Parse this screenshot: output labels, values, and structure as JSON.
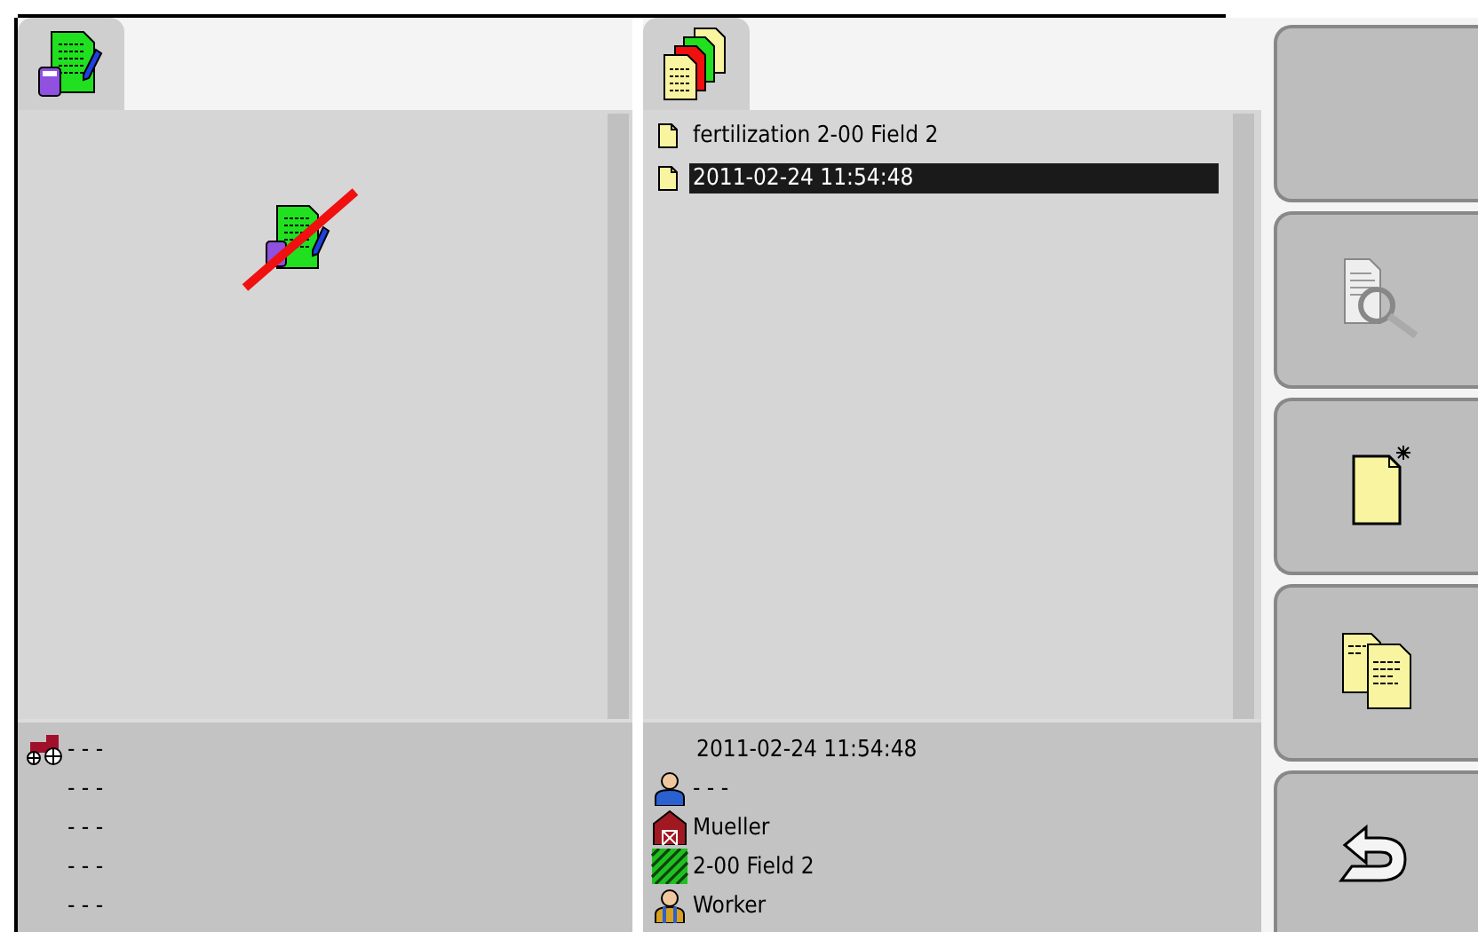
{
  "left_panel": {
    "info_rows": [
      {
        "kind": "machine",
        "text": "- - -"
      },
      {
        "kind": "plain",
        "text": "- - -"
      },
      {
        "kind": "plain",
        "text": "- - -"
      },
      {
        "kind": "plain",
        "text": "- - -"
      },
      {
        "kind": "plain",
        "text": "- - -"
      }
    ]
  },
  "middle_panel": {
    "list": [
      {
        "text": "fertilization 2-00 Field 2",
        "selected": false
      },
      {
        "text": "2011-02-24 11:54:48",
        "selected": true
      }
    ],
    "info_rows": [
      {
        "kind": "plain",
        "text": "2011-02-24 11:54:48"
      },
      {
        "kind": "person",
        "text": "- - -"
      },
      {
        "kind": "farm",
        "text": "Mueller"
      },
      {
        "kind": "field",
        "text": "2-00 Field 2"
      },
      {
        "kind": "worker",
        "text": "Worker"
      }
    ]
  },
  "side_buttons": [
    {
      "kind": "empty"
    },
    {
      "kind": "view"
    },
    {
      "kind": "new"
    },
    {
      "kind": "copy"
    },
    {
      "kind": "back"
    }
  ]
}
